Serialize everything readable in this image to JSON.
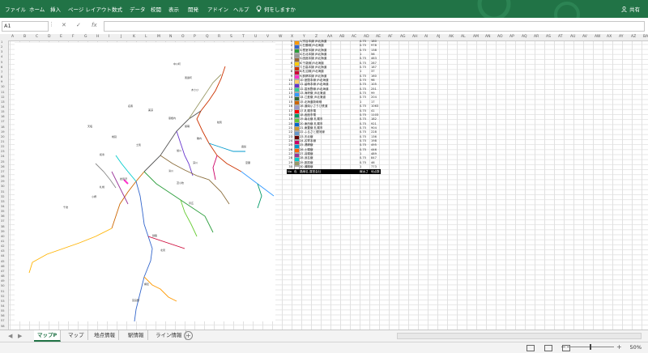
{
  "ribbon": {
    "tabs": [
      "ファイル",
      "ホーム",
      "挿入",
      "ページ レイアウト",
      "数式",
      "データ",
      "校閲",
      "表示",
      "開発",
      "アドイン",
      "ヘルプ"
    ],
    "tellme": "何をしますか",
    "share": "共有",
    "bg_color": "#217346"
  },
  "formula_bar": {
    "name_box": "A1",
    "cancel": "✕",
    "enter": "✓",
    "fx": "fx"
  },
  "columns": [
    "A",
    "B",
    "C",
    "D",
    "E",
    "F",
    "G",
    "H",
    "I",
    "J",
    "K",
    "L",
    "M",
    "N",
    "O",
    "P",
    "Q",
    "R",
    "S",
    "T",
    "U",
    "V",
    "W",
    "X",
    "Y",
    "Z",
    "AA",
    "AB",
    "AC",
    "AD",
    "AE",
    "AF",
    "AG",
    "AH",
    "AI",
    "AJ",
    "AK",
    "AL",
    "AM",
    "AN",
    "AO",
    "AP",
    "AQ",
    "AR",
    "AS",
    "AT",
    "AU",
    "AV",
    "AW",
    "AX",
    "AY",
    "AZ",
    "BA"
  ],
  "row_count": 58,
  "map": {
    "labels": [
      "中川町",
      "風連町",
      "あさひ",
      "名寄",
      "美深",
      "恩根内",
      "天塩",
      "幌延",
      "士別",
      "和寒",
      "旭川",
      "深川",
      "滝川",
      "岩見沢",
      "札幌",
      "小樽",
      "千歳",
      "苫小牧",
      "室蘭",
      "函館",
      "帯広",
      "釧路",
      "北見",
      "網走",
      "富良野",
      "留萌",
      "稚内",
      "紋別"
    ]
  },
  "legend": {
    "header": {
      "no": "No",
      "color": "色",
      "name": "路線名,運営会社",
      "width": "線太さ",
      "points": "地点数"
    },
    "items": [
      {
        "no": "1",
        "color": "#ff9900",
        "name": "1.宗谷本線 JR北海道",
        "w": "0.75",
        "p": "180"
      },
      {
        "no": "2",
        "color": "#3366cc",
        "name": "2.石勝線 JR北海道",
        "w": "0.75",
        "p": "978"
      },
      {
        "no": "3",
        "color": "#2a9d3b",
        "name": "3.根室本線 JR北海道",
        "w": "0.75",
        "p": "138"
      },
      {
        "no": "4",
        "color": "#999999",
        "name": "4.石北本線 JR北海道",
        "w": "1",
        "p": "56"
      },
      {
        "no": "5",
        "color": "#996633",
        "name": "5.函館本線 JR北海道",
        "w": "0.75",
        "p": "463"
      },
      {
        "no": "6",
        "color": "#ffcc00",
        "name": "6.千歳線 JR北海道",
        "w": "0.75",
        "p": "287"
      },
      {
        "no": "7",
        "color": "#cc3300",
        "name": "7.日高本線 JR北海道",
        "w": "0.75",
        "p": "187"
      },
      {
        "no": "8",
        "color": "#cc0033",
        "name": "8.札沼線 JR北海道",
        "w": "1",
        "p": "37"
      },
      {
        "no": "9",
        "color": "#ff33cc",
        "name": "9.釧網本線 JR北海道",
        "w": "0.75",
        "p": "160"
      },
      {
        "no": "10",
        "color": "#ffcc66",
        "name": "10.室蘭本線 JR北海道",
        "w": "0.75",
        "p": "98"
      },
      {
        "no": "11",
        "color": "#6633cc",
        "name": "11.留萌本線 JR北海道",
        "w": "0.75",
        "p": "105"
      },
      {
        "no": "12",
        "color": "#33cc99",
        "name": "12.富良野線 JR北海道",
        "w": "0.75",
        "p": "251"
      },
      {
        "no": "13",
        "color": "#3399ff",
        "name": "13.海峡線 JR北海道",
        "w": "0.75",
        "p": "99"
      },
      {
        "no": "14",
        "color": "#336633",
        "name": "14.江差線 JR北海道",
        "w": "0.75",
        "p": "204"
      },
      {
        "no": "15",
        "color": "#cc6600",
        "name": "15.北海道新幹線",
        "w": "1",
        "p": "17"
      },
      {
        "no": "16",
        "color": "#9999cc",
        "name": "16.道南いさりび鉄道",
        "w": "0.75",
        "p": "1063"
      },
      {
        "no": "17",
        "color": "#ff0000",
        "name": "17.札幌市電",
        "w": "0.75",
        "p": "41"
      },
      {
        "no": "18",
        "color": "#009966",
        "name": "18.函館市電",
        "w": "0.75",
        "p": "1103"
      },
      {
        "no": "19",
        "color": "#66cc33",
        "name": "19.南北線 札幌市",
        "w": "0.75",
        "p": "182"
      },
      {
        "no": "20",
        "color": "#0066cc",
        "name": "20.東西線 札幌市",
        "w": "0.75",
        "p": "921"
      },
      {
        "no": "21",
        "color": "#cc9933",
        "name": "21.東豊線 札幌市",
        "w": "0.75",
        "p": "904"
      },
      {
        "no": "22",
        "color": "#6699cc",
        "name": "22.ふるさと銀河線",
        "w": "0.75",
        "p": "228"
      },
      {
        "no": "23",
        "color": "#660000",
        "name": "23.天北線",
        "w": "0.75",
        "p": "136"
      },
      {
        "no": "24",
        "color": "#cc0066",
        "name": "24.名寄本線",
        "w": "0.75",
        "p": "198"
      },
      {
        "no": "25",
        "color": "#0099cc",
        "name": "25.湧網線",
        "w": "0.75",
        "p": "495"
      },
      {
        "no": "26",
        "color": "#ff6600",
        "name": "26.士幌線",
        "w": "0.75",
        "p": "446"
      },
      {
        "no": "27",
        "color": "#993399",
        "name": "27.羽幌線",
        "w": "1",
        "p": "489"
      },
      {
        "no": "28",
        "color": "#00cccc",
        "name": "28.深名線",
        "w": "0.75",
        "p": "847"
      },
      {
        "no": "29",
        "color": "#999966",
        "name": "29.胆振線",
        "w": "0.75",
        "p": "46"
      },
      {
        "no": "30",
        "color": "#ffffff",
        "name": "30.瀬棚線",
        "w": "1",
        "p": "773"
      }
    ]
  },
  "sheet_tabs": {
    "tabs": [
      "マップP",
      "マップ",
      "地点情報",
      "駅情報",
      "ライン情報"
    ],
    "active": "マップP",
    "add": "+"
  },
  "status": {
    "zoom": "50%",
    "minus": "−",
    "plus": "+"
  }
}
